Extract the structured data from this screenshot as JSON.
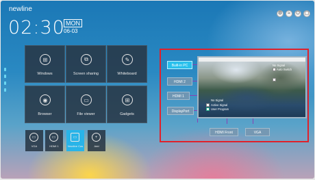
{
  "header": {
    "brand": "newline",
    "time": "02:30",
    "day": "MON",
    "date": "06-03"
  },
  "top_icons": [
    "settings-icon",
    "wifi-icon",
    "power-icon",
    "window-icon"
  ],
  "tiles": [
    {
      "label": "Windows",
      "icon": "windows-icon",
      "glyph": "⊞"
    },
    {
      "label": "Screen sharing",
      "icon": "screen-share-icon",
      "glyph": "⧉"
    },
    {
      "label": "Whiteboard",
      "icon": "pen-icon",
      "glyph": "✎"
    },
    {
      "label": "Browser",
      "icon": "browser-icon",
      "glyph": "◉"
    },
    {
      "label": "File viewer",
      "icon": "folder-icon",
      "glyph": "▭"
    },
    {
      "label": "Gadgets",
      "icon": "grid-icon",
      "glyph": "⊞"
    }
  ],
  "sources": [
    {
      "label": "VGA",
      "icon": "vga-icon",
      "glyph": "▭",
      "active": false
    },
    {
      "label": "HDMI 1",
      "icon": "hdmi-icon",
      "glyph": "▭",
      "active": false
    },
    {
      "label": "Newline Cas",
      "icon": "cast-icon",
      "glyph": "▭",
      "active": true
    },
    {
      "label": "Add",
      "icon": "add-icon",
      "glyph": "+",
      "active": false
    }
  ],
  "channels": [
    {
      "label": "Built-in PC",
      "active": true
    },
    {
      "label": "HDMI 2",
      "active": false
    },
    {
      "label": "HDMI 1",
      "active": false
    },
    {
      "label": "DisplayPort",
      "active": false
    },
    {
      "label": "HDMI Front",
      "active": false
    },
    {
      "label": "VGA",
      "active": false
    }
  ],
  "preview": {
    "no_signal": "No Signal",
    "options": [
      "Active Signal",
      "User Program"
    ],
    "top_right_labels": [
      "No Signal",
      "Auto Switch"
    ]
  },
  "colors": {
    "accent": "#29c0ec",
    "highlight_border": "#e0202a",
    "connector": "#8a3fb5"
  }
}
